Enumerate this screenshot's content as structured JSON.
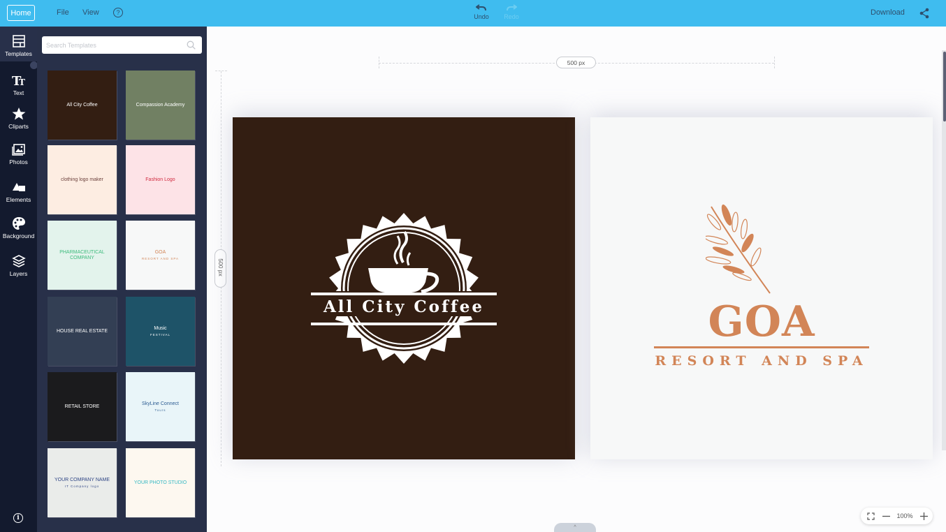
{
  "topbar": {
    "home_label": "Home",
    "menu": [
      "File",
      "View"
    ],
    "help_glyph": "?",
    "undo_label": "Undo",
    "redo_label": "Redo",
    "download_label": "Download",
    "share_icon": "share-icon"
  },
  "rail": {
    "items": [
      {
        "label": "Templates",
        "icon": "templates-icon"
      },
      {
        "label": "Text",
        "icon": "text-icon"
      },
      {
        "label": "Cliparts",
        "icon": "star-icon"
      },
      {
        "label": "Photos",
        "icon": "photos-icon"
      },
      {
        "label": "Elements",
        "icon": "elements-icon"
      },
      {
        "label": "Background",
        "icon": "palette-icon"
      },
      {
        "label": "Layers",
        "icon": "layers-icon"
      }
    ],
    "info_glyph": "i"
  },
  "panel": {
    "search_placeholder": "Search Templates",
    "templates": [
      {
        "title": "All City Coffee",
        "subtitle": "",
        "bg": "#331e12",
        "fg": "#ffffff"
      },
      {
        "title": "Compassion Academy",
        "subtitle": "",
        "bg": "#718063",
        "fg": "#ffffff"
      },
      {
        "title": "clothing logo maker",
        "subtitle": "",
        "bg": "#fdede2",
        "fg": "#6a3f3a"
      },
      {
        "title": "Fashion Logo",
        "subtitle": "",
        "bg": "#fde3e7",
        "fg": "#d12b40"
      },
      {
        "title": "PHARMACEUTICAL COMPANY",
        "subtitle": "",
        "bg": "#e3f3ec",
        "fg": "#3dbb7c"
      },
      {
        "title": "GOA",
        "subtitle": "RESORT AND SPA",
        "bg": "#f7f8f8",
        "fg": "#d28557"
      },
      {
        "title": "HOUSE REAL ESTATE",
        "subtitle": "",
        "bg": "#333f54",
        "fg": "#ffffff"
      },
      {
        "title": "Music",
        "subtitle": "FESTIVAL",
        "bg": "#1e5368",
        "fg": "#ffffff"
      },
      {
        "title": "RETAIL STORE",
        "subtitle": "",
        "bg": "#1b1b1d",
        "fg": "#ffffff"
      },
      {
        "title": "SkyLine Connect",
        "subtitle": "Tours",
        "bg": "#e9f5f9",
        "fg": "#2c5c92"
      },
      {
        "title": "YOUR COMPANY NAME",
        "subtitle": "IT Company logo",
        "bg": "#eaecea",
        "fg": "#2f4585"
      },
      {
        "title": "YOUR PHOTO STUDIO",
        "subtitle": "",
        "bg": "#fdf8f0",
        "fg": "#36b8c3"
      }
    ]
  },
  "canvas": {
    "width_label": "500 px",
    "height_label": "500 px",
    "pages": [
      {
        "title": "All City Coffee",
        "bg": "#331e12",
        "fg": "#ffffff"
      },
      {
        "title": "GOA",
        "subtitle": "RESORT AND SPA",
        "bg": "#f7f8f8",
        "fg": "#d28557"
      }
    ],
    "zoom_level": "100%",
    "bottom_handle_glyph": "^"
  }
}
